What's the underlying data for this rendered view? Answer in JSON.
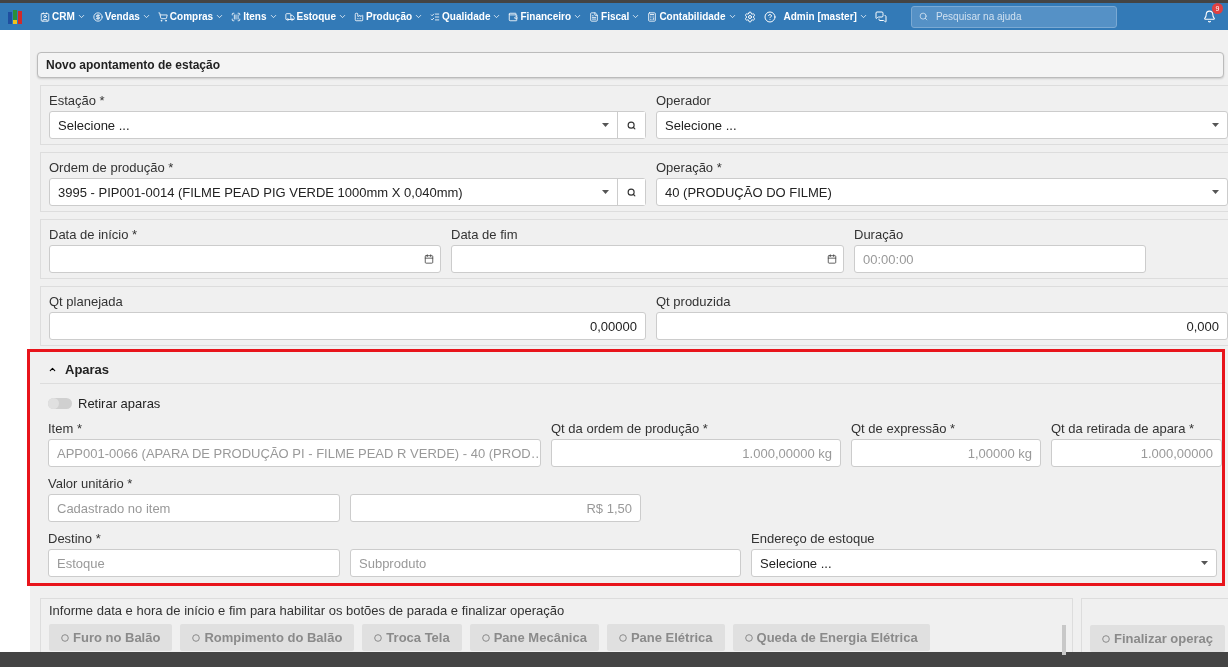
{
  "topbar": {
    "menu": [
      {
        "label": "CRM"
      },
      {
        "label": "Vendas"
      },
      {
        "label": "Compras"
      },
      {
        "label": "Itens"
      },
      {
        "label": "Estoque"
      },
      {
        "label": "Produção"
      },
      {
        "label": "Qualidade"
      },
      {
        "label": "Financeiro"
      },
      {
        "label": "Fiscal"
      },
      {
        "label": "Contabilidade"
      }
    ],
    "user": "Admin [master]",
    "search": {
      "placeholder": "Pesquisar na ajuda"
    },
    "notifications": "9"
  },
  "title": "Novo apontamento de estação",
  "rows": [
    [
      {
        "label": "Estação *",
        "kind": "select",
        "value": "Selecione ...",
        "search": true
      },
      {
        "label": "Operador",
        "kind": "select",
        "value": "Selecione ..."
      }
    ],
    [
      {
        "label": "Ordem de produção *",
        "kind": "select",
        "value": "3995 - PIP001-0014 (FILME PEAD PIG VERDE 1000mm X 0,040mm)",
        "search": true
      },
      {
        "label": "Operação *",
        "kind": "select",
        "value": "40 (PRODUÇÃO DO FILME)"
      }
    ],
    [
      {
        "label": "Data de início *",
        "kind": "date"
      },
      {
        "label": "Data de fim",
        "kind": "date"
      },
      {
        "label": "Duração",
        "kind": "text",
        "placeholder": "00:00:00"
      }
    ],
    [
      {
        "label": "Qt planejada",
        "kind": "number",
        "value": "0,00000"
      },
      {
        "label": "Qt produzida",
        "kind": "number",
        "value": "0,000"
      }
    ]
  ],
  "aparas": {
    "title": "Aparas",
    "expanded": true,
    "toggle": {
      "label": "Retirar aparas",
      "on": false
    },
    "rows": [
      [
        {
          "label": "Item *",
          "kind": "text",
          "value": "APP001-0066 (APARA DE PRODUÇÃO PI - FILME PEAD R VERDE) - 40 (PROD…",
          "disabled": true
        },
        {
          "label": "Qt da ordem de produção *",
          "kind": "number",
          "value": "1.000,00000 kg",
          "disabled": true
        },
        {
          "label": "Qt de expressão *",
          "kind": "number",
          "value": "1,00000 kg",
          "disabled": true
        },
        {
          "label": "Qt da retirada de apara *",
          "kind": "number",
          "value": "1.000,00000",
          "disabled": true
        }
      ],
      [
        {
          "label": "Valor unitário *",
          "kind": "text",
          "value": "Cadastrado no item",
          "disabled": true
        },
        {
          "kind": "number",
          "value": "R$ 1,50",
          "disabled": true
        }
      ],
      [
        {
          "label": "Destino *",
          "kind": "text",
          "value": "Estoque",
          "disabled": true
        },
        {
          "kind": "text",
          "value": "Subproduto",
          "disabled": true
        },
        {
          "label": "Endereço de estoque",
          "kind": "select",
          "value": "Selecione ...",
          "disabled": false
        }
      ]
    ]
  },
  "footer": {
    "hint": "Informe data e hora de início e fim para habilitar os botões de parada e finalizar operação",
    "stop_buttons": [
      {
        "label": "Furo no Balão",
        "disabled": true
      },
      {
        "label": "Rompimento do Balão",
        "disabled": true
      },
      {
        "label": "Troca Tela",
        "disabled": true
      },
      {
        "label": "Pane Mecânica",
        "disabled": true
      },
      {
        "label": "Pane Elétrica",
        "disabled": true
      },
      {
        "label": "Queda de Energia Elétrica",
        "disabled": true
      }
    ],
    "finish_button": {
      "label": "Finalizar operaç",
      "disabled": true
    }
  }
}
